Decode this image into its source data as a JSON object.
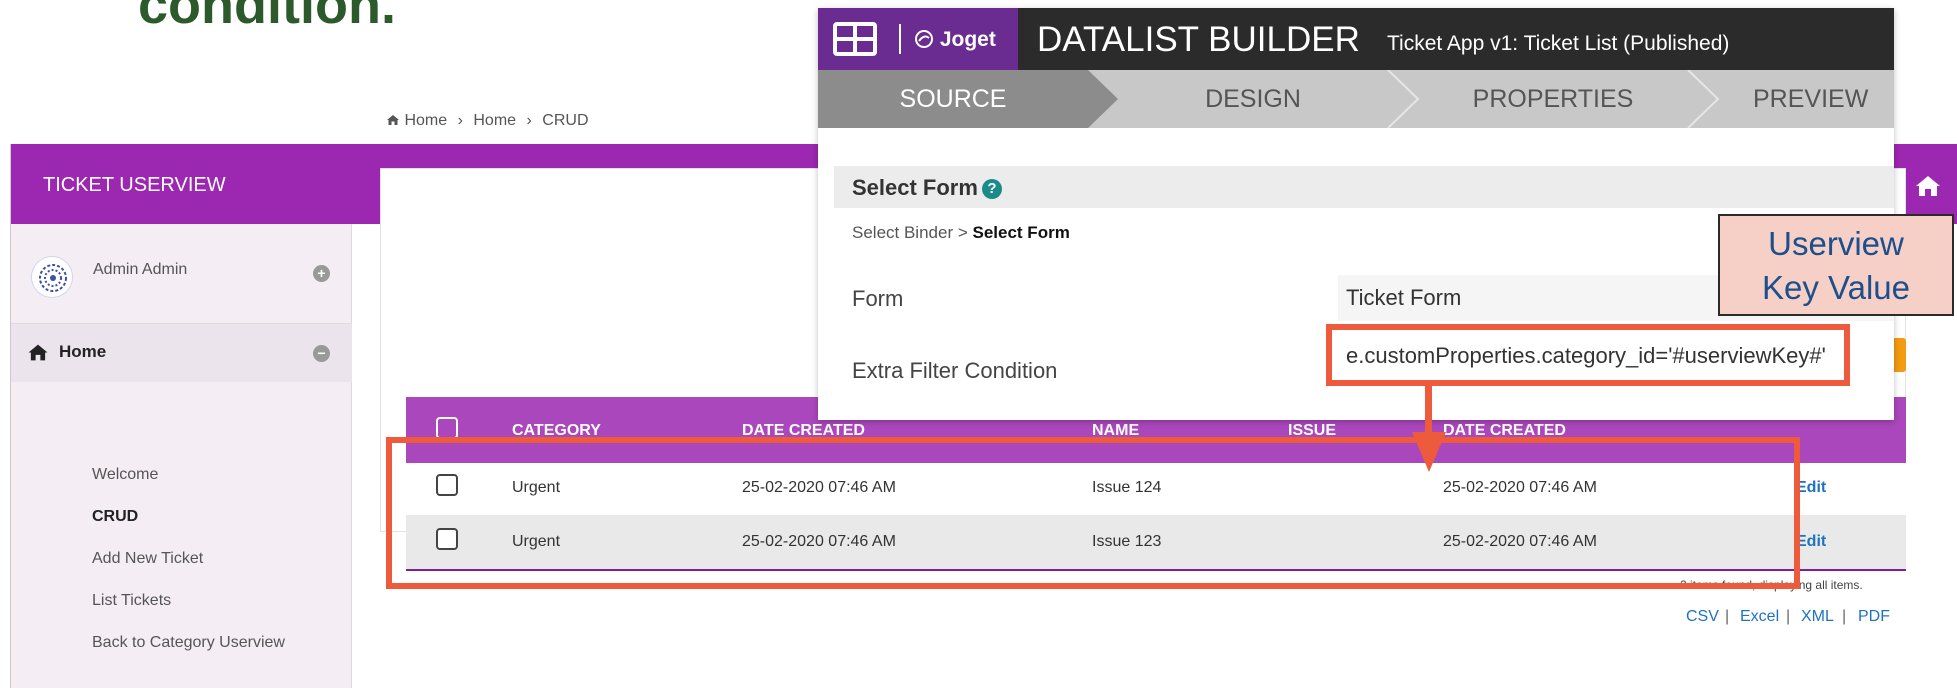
{
  "slide": {
    "title_fragment": "condition."
  },
  "userview": {
    "title": "TICKET USERVIEW",
    "user_name": "Admin Admin",
    "user_toggle": "+",
    "home_label": "Home",
    "home_toggle": "−",
    "menu": [
      "Welcome",
      "CRUD",
      "Add New Ticket",
      "List Tickets",
      "Back to Category Userview"
    ],
    "active_menu": "CRUD",
    "breadcrumb": [
      "Home",
      "Home",
      "CRUD"
    ]
  },
  "table": {
    "columns": [
      "CATEGORY",
      "DATE CREATED",
      "NAME",
      "ISSUE",
      "DATE CREATED"
    ],
    "rows": [
      {
        "category": "Urgent",
        "date_created": "25-02-2020 07:46 AM",
        "name": "Issue 124",
        "issue": "",
        "date_created_2": "25-02-2020 07:46 AM",
        "action": "Edit"
      },
      {
        "category": "Urgent",
        "date_created": "25-02-2020 07:46 AM",
        "name": "Issue 123",
        "issue": "",
        "date_created_2": "25-02-2020 07:46 AM",
        "action": "Edit"
      }
    ],
    "footer_note": "2 items found, displaying all items.",
    "exports": [
      "CSV",
      "Excel",
      "XML",
      "PDF"
    ]
  },
  "builder": {
    "logo_text": "Joget",
    "title": "DATALIST BUILDER",
    "subtitle": "Ticket App v1: Ticket List (Published)",
    "tabs": [
      "SOURCE",
      "DESIGN",
      "PROPERTIES",
      "PREVIEW"
    ],
    "active_tab": "SOURCE",
    "section_title": "Select Form",
    "crumb_prefix": "Select Binder >",
    "crumb_current": "Select Form",
    "form_label": "Form",
    "form_value": "Ticket Form",
    "filter_label": "Extra Filter Condition",
    "filter_value": "e.customProperties.category_id='#userviewKey#'"
  },
  "annotation": {
    "line1": "Userview",
    "line2": "Key Value"
  },
  "colors": {
    "userview_purple": "#9c27b0",
    "table_header": "#ab47bc",
    "builder_logo": "#6a2c91",
    "annotation_red": "#ee5a3c"
  }
}
